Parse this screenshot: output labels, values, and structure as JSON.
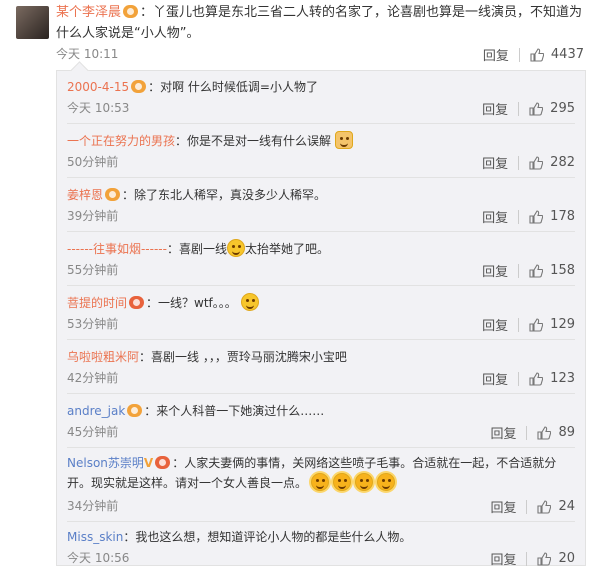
{
  "main_comment": {
    "user": "某个李泽晨",
    "text": "：丫蛋儿也算是东北三省二人转的名家了，论喜剧也算是一线演员，不知道为什么人家说是“小人物”。",
    "time": "今天 10:11",
    "reply_label": "回复",
    "likes": "4437"
  },
  "replies": [
    {
      "user": "2000-4-15",
      "text": "：对啊 什么时候低调=小人物了",
      "time": "今天 10:53",
      "reply_label": "回复",
      "likes": "295"
    },
    {
      "user": "一个正在努力的男孩",
      "text": "：你是不是对一线有什么误解",
      "time": "50分钟前",
      "reply_label": "回复",
      "likes": "282"
    },
    {
      "user": "姜梓恩",
      "text": "：除了东北人稀罕，真没多少人稀罕。",
      "time": "39分钟前",
      "reply_label": "回复",
      "likes": "178"
    },
    {
      "user": "------往事如烟------",
      "text": "：喜剧一线",
      "text2": "太抬举她了吧。",
      "time": "55分钟前",
      "reply_label": "回复",
      "likes": "158"
    },
    {
      "user": "菩提的时间",
      "text": "：一线？wtf。。。",
      "time": "53分钟前",
      "reply_label": "回复",
      "likes": "129"
    },
    {
      "user": "乌啦啦粗米阿",
      "text": "：喜剧一线  ，，，贾玲马丽沈腾宋小宝吧",
      "time": "42分钟前",
      "reply_label": "回复",
      "likes": "123"
    },
    {
      "user": "andre_jak",
      "text": "：来个人科普一下她演过什么……",
      "time": "45分钟前",
      "reply_label": "回复",
      "likes": "89"
    },
    {
      "user": "Nelson苏崇明",
      "text": "：人家夫妻俩的事情，关网络这些喷子毛事。合适就在一起，不合适就分开。现实就是这样。请对一个女人善良一点。",
      "time": "34分钟前",
      "reply_label": "回复",
      "likes": "24"
    },
    {
      "user": "Miss_skin",
      "text": "：我也这么想，想知道评论小人物的都是些什么人物。",
      "time": "今天 10:56",
      "reply_label": "回复",
      "likes": "20"
    }
  ],
  "colors": {
    "username": "#eb7350",
    "link": "#5a7fc7",
    "panel": "#f2f2f5"
  }
}
